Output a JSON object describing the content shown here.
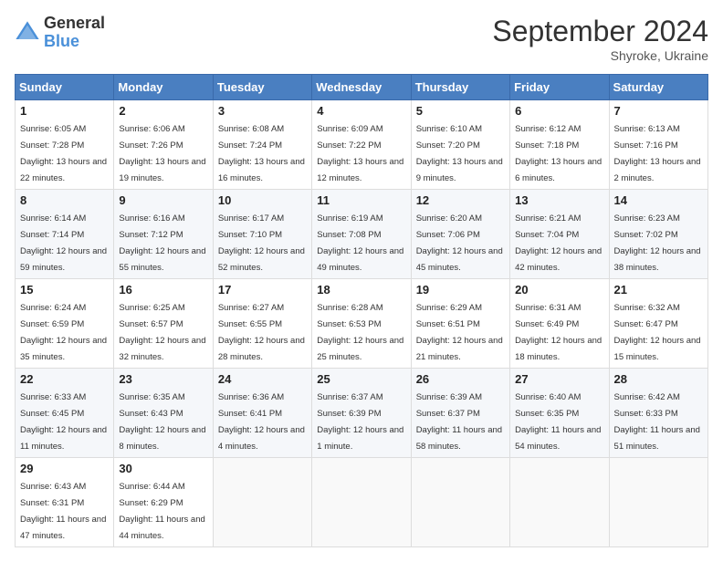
{
  "logo": {
    "general": "General",
    "blue": "Blue"
  },
  "title": {
    "month_year": "September 2024",
    "location": "Shyroke, Ukraine"
  },
  "calendar": {
    "headers": [
      "Sunday",
      "Monday",
      "Tuesday",
      "Wednesday",
      "Thursday",
      "Friday",
      "Saturday"
    ],
    "weeks": [
      [
        {
          "day": "1",
          "sunrise": "6:05 AM",
          "sunset": "7:28 PM",
          "daylight": "13 hours and 22 minutes."
        },
        {
          "day": "2",
          "sunrise": "6:06 AM",
          "sunset": "7:26 PM",
          "daylight": "13 hours and 19 minutes."
        },
        {
          "day": "3",
          "sunrise": "6:08 AM",
          "sunset": "7:24 PM",
          "daylight": "13 hours and 16 minutes."
        },
        {
          "day": "4",
          "sunrise": "6:09 AM",
          "sunset": "7:22 PM",
          "daylight": "13 hours and 12 minutes."
        },
        {
          "day": "5",
          "sunrise": "6:10 AM",
          "sunset": "7:20 PM",
          "daylight": "13 hours and 9 minutes."
        },
        {
          "day": "6",
          "sunrise": "6:12 AM",
          "sunset": "7:18 PM",
          "daylight": "13 hours and 6 minutes."
        },
        {
          "day": "7",
          "sunrise": "6:13 AM",
          "sunset": "7:16 PM",
          "daylight": "13 hours and 2 minutes."
        }
      ],
      [
        {
          "day": "8",
          "sunrise": "6:14 AM",
          "sunset": "7:14 PM",
          "daylight": "12 hours and 59 minutes."
        },
        {
          "day": "9",
          "sunrise": "6:16 AM",
          "sunset": "7:12 PM",
          "daylight": "12 hours and 55 minutes."
        },
        {
          "day": "10",
          "sunrise": "6:17 AM",
          "sunset": "7:10 PM",
          "daylight": "12 hours and 52 minutes."
        },
        {
          "day": "11",
          "sunrise": "6:19 AM",
          "sunset": "7:08 PM",
          "daylight": "12 hours and 49 minutes."
        },
        {
          "day": "12",
          "sunrise": "6:20 AM",
          "sunset": "7:06 PM",
          "daylight": "12 hours and 45 minutes."
        },
        {
          "day": "13",
          "sunrise": "6:21 AM",
          "sunset": "7:04 PM",
          "daylight": "12 hours and 42 minutes."
        },
        {
          "day": "14",
          "sunrise": "6:23 AM",
          "sunset": "7:02 PM",
          "daylight": "12 hours and 38 minutes."
        }
      ],
      [
        {
          "day": "15",
          "sunrise": "6:24 AM",
          "sunset": "6:59 PM",
          "daylight": "12 hours and 35 minutes."
        },
        {
          "day": "16",
          "sunrise": "6:25 AM",
          "sunset": "6:57 PM",
          "daylight": "12 hours and 32 minutes."
        },
        {
          "day": "17",
          "sunrise": "6:27 AM",
          "sunset": "6:55 PM",
          "daylight": "12 hours and 28 minutes."
        },
        {
          "day": "18",
          "sunrise": "6:28 AM",
          "sunset": "6:53 PM",
          "daylight": "12 hours and 25 minutes."
        },
        {
          "day": "19",
          "sunrise": "6:29 AM",
          "sunset": "6:51 PM",
          "daylight": "12 hours and 21 minutes."
        },
        {
          "day": "20",
          "sunrise": "6:31 AM",
          "sunset": "6:49 PM",
          "daylight": "12 hours and 18 minutes."
        },
        {
          "day": "21",
          "sunrise": "6:32 AM",
          "sunset": "6:47 PM",
          "daylight": "12 hours and 15 minutes."
        }
      ],
      [
        {
          "day": "22",
          "sunrise": "6:33 AM",
          "sunset": "6:45 PM",
          "daylight": "12 hours and 11 minutes."
        },
        {
          "day": "23",
          "sunrise": "6:35 AM",
          "sunset": "6:43 PM",
          "daylight": "12 hours and 8 minutes."
        },
        {
          "day": "24",
          "sunrise": "6:36 AM",
          "sunset": "6:41 PM",
          "daylight": "12 hours and 4 minutes."
        },
        {
          "day": "25",
          "sunrise": "6:37 AM",
          "sunset": "6:39 PM",
          "daylight": "12 hours and 1 minute."
        },
        {
          "day": "26",
          "sunrise": "6:39 AM",
          "sunset": "6:37 PM",
          "daylight": "11 hours and 58 minutes."
        },
        {
          "day": "27",
          "sunrise": "6:40 AM",
          "sunset": "6:35 PM",
          "daylight": "11 hours and 54 minutes."
        },
        {
          "day": "28",
          "sunrise": "6:42 AM",
          "sunset": "6:33 PM",
          "daylight": "11 hours and 51 minutes."
        }
      ],
      [
        {
          "day": "29",
          "sunrise": "6:43 AM",
          "sunset": "6:31 PM",
          "daylight": "11 hours and 47 minutes."
        },
        {
          "day": "30",
          "sunrise": "6:44 AM",
          "sunset": "6:29 PM",
          "daylight": "11 hours and 44 minutes."
        },
        null,
        null,
        null,
        null,
        null
      ]
    ]
  }
}
